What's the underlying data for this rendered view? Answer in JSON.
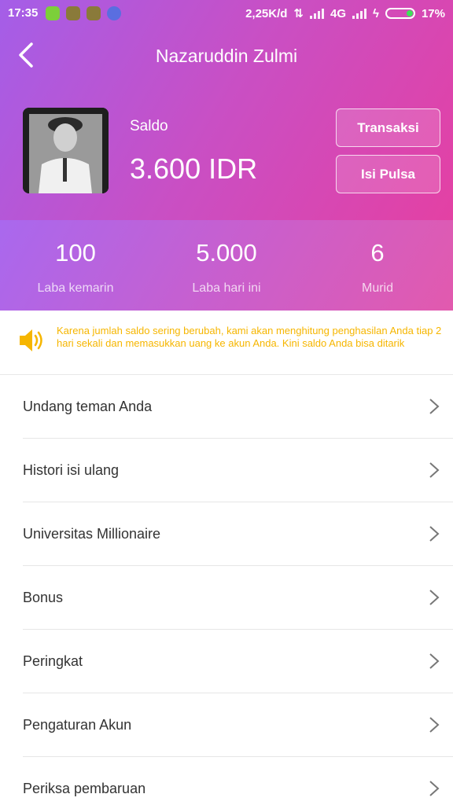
{
  "status_bar": {
    "time": "17:35",
    "network_speed": "2,25K/d",
    "network_type": "4G",
    "battery": "17%",
    "notification_icons": [
      "phone-icon",
      "app-icon",
      "app-icon",
      "browser-icon"
    ]
  },
  "header": {
    "title": "Nazaruddin Zulmi"
  },
  "balance": {
    "label": "Saldo",
    "value": "3.600 IDR"
  },
  "buttons": {
    "transaksi": "Transaksi",
    "isi_pulsa": "Isi Pulsa"
  },
  "stats": [
    {
      "value": "100",
      "label": "Laba kemarin"
    },
    {
      "value": "5.000",
      "label": "Laba hari ini"
    },
    {
      "value": "6",
      "label": "Murid"
    }
  ],
  "notice": {
    "text": "Karena jumlah saldo sering berubah, kami akan menghitung penghasilan Anda tiap 2 hari sekali dan memasukkan uang ke akun Anda. Kini saldo Anda bisa ditarik"
  },
  "menu": [
    {
      "label": "Undang teman Anda"
    },
    {
      "label": "Histori isi ulang"
    },
    {
      "label": "Universitas Millionaire"
    },
    {
      "label": "Bonus"
    },
    {
      "label": "Peringkat"
    },
    {
      "label": "Pengaturan Akun"
    },
    {
      "label": "Periksa pembaruan"
    }
  ],
  "colors": {
    "gradient_start": "#a45ee8",
    "gradient_end": "#e83e9e",
    "notice_text": "#f6b600",
    "speaker_icon": "#f6b600"
  }
}
